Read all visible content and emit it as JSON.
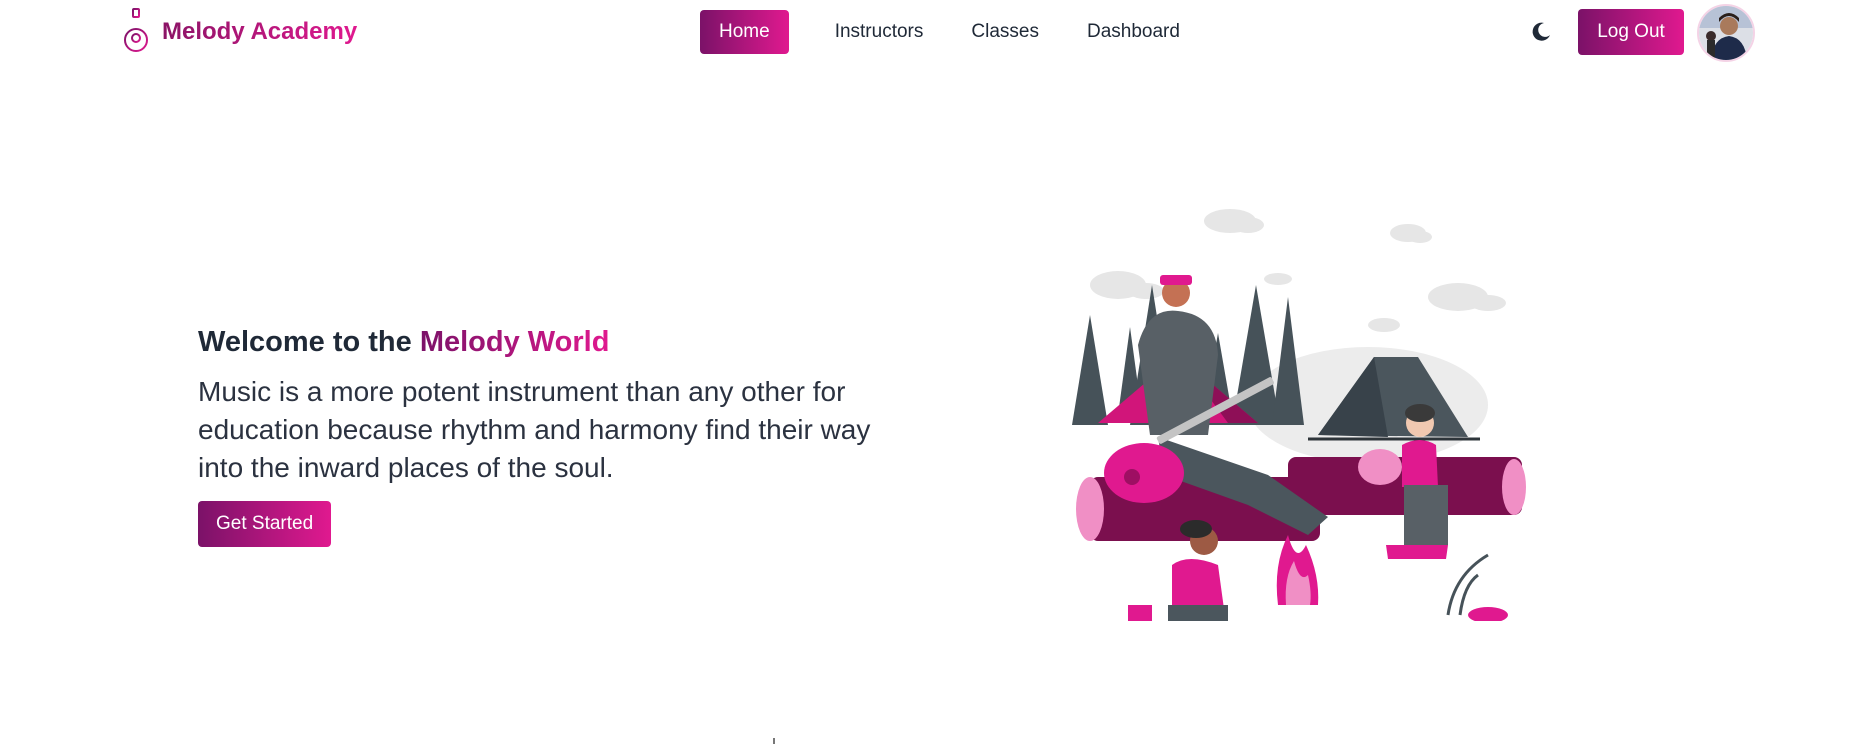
{
  "brand": {
    "name": "Melody Academy",
    "logo_icon": "guitar-icon",
    "accent": "#e0198f",
    "accent_dark": "#7b1268"
  },
  "nav": {
    "items": [
      {
        "label": "Home",
        "active": true
      },
      {
        "label": "Instructors",
        "active": false
      },
      {
        "label": "Classes",
        "active": false
      },
      {
        "label": "Dashboard",
        "active": false
      }
    ],
    "theme_icon": "moon-icon",
    "logout_label": "Log Out",
    "avatar_icon": "user-avatar"
  },
  "hero": {
    "title_prefix": "Welcome to the ",
    "title_highlight": "Melody World",
    "description": "Music is a more potent instrument than any other for education because rhythm and harmony find their way into the inward places of the soul.",
    "cta_label": "Get Started",
    "illustration": "campfire-music-illustration"
  }
}
